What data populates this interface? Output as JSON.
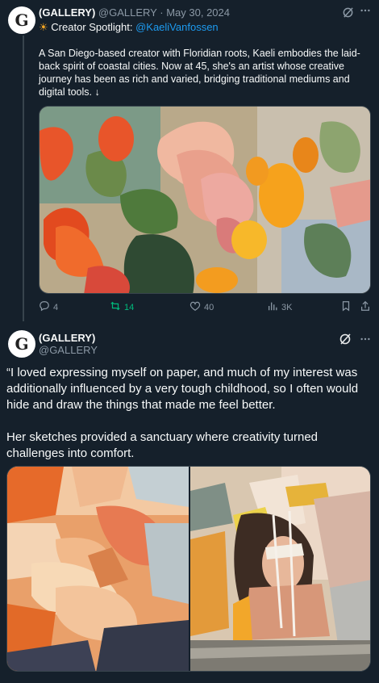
{
  "tweet1": {
    "avatar_letter": "G",
    "name": "(GALLERY)",
    "handle": "@GALLERY",
    "separator": "·",
    "date": "May 30, 2024",
    "spotlight_prefix": "Creator Spotlight:",
    "spotlight_mention": "@KaeliVanfossen",
    "text": "A San Diego-based creator with Floridian roots, Kaeli embodies the laid-back spirit of coastal cities. Now at 45, she's an artist whose creative journey has been as rich and varied, bridging traditional mediums and digital tools. ↓",
    "actions": {
      "replies": "4",
      "reposts": "14",
      "likes": "40",
      "views": "3K"
    }
  },
  "tweet2": {
    "avatar_letter": "G",
    "name": "(GALLERY)",
    "handle": "@GALLERY",
    "paragraph1": "“I loved expressing myself on paper, and much of my interest was additionally influenced by a very tough childhood, so I often would hide and draw the things that made me feel better.",
    "paragraph2": "Her sketches provided a sanctuary where creativity turned challenges into comfort."
  },
  "icons": {
    "grok": "grok-icon",
    "more": "more-icon",
    "reply": "reply-icon",
    "repost": "repost-icon",
    "like": "like-icon",
    "views": "views-icon",
    "bookmark": "bookmark-icon",
    "share": "share-icon"
  },
  "colors": {
    "background": "#15202b",
    "text": "#f7f9f9",
    "muted": "#8b98a5",
    "link": "#1d9bf0",
    "repost_active": "#00ba7c"
  }
}
